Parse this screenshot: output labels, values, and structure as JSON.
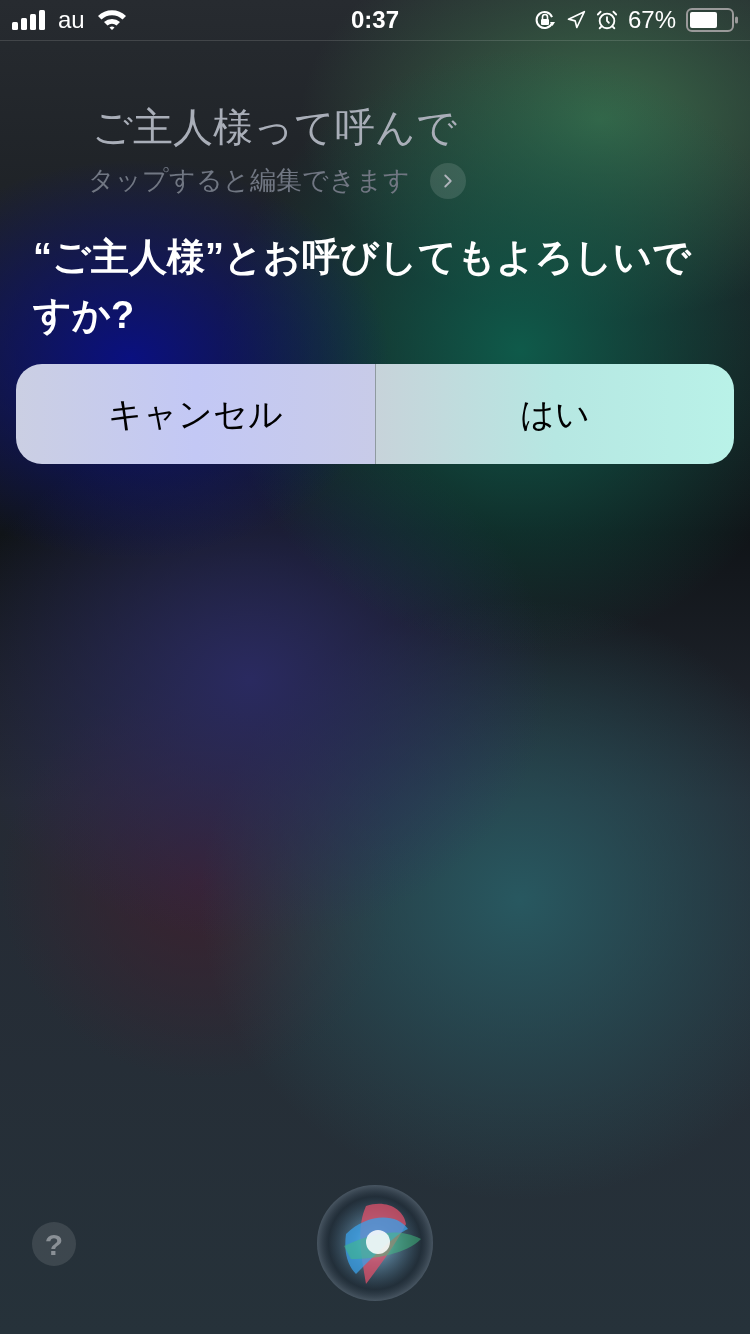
{
  "status_bar": {
    "carrier": "au",
    "time": "0:37",
    "battery_percent": "67%"
  },
  "transcript": {
    "text": "ご主人様って呼んで",
    "hint": "タップすると編集できます"
  },
  "question": "“ご主人様”とお呼びしてもよろしいですか?",
  "buttons": [
    {
      "label": "キャンセル",
      "kind": "cancel"
    },
    {
      "label": "はい",
      "kind": "confirm"
    }
  ],
  "help_button": {
    "label": "?"
  }
}
